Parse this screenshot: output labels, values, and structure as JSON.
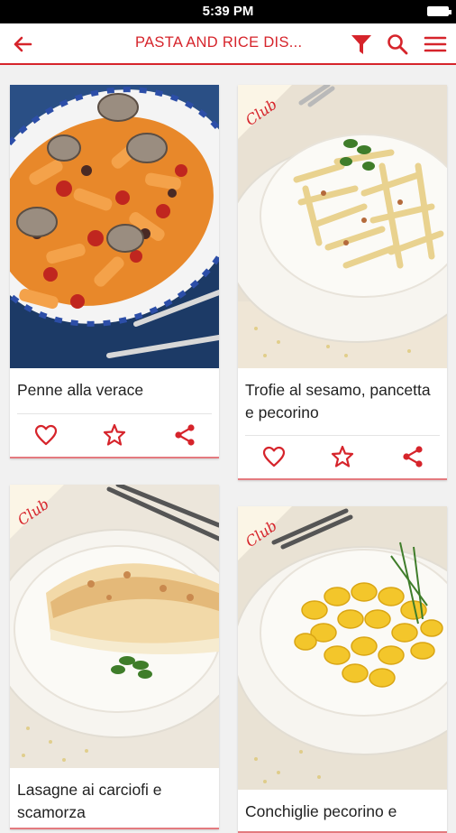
{
  "status_bar": {
    "time": "5:39 PM"
  },
  "app_bar": {
    "title": "PASTA AND RICE DIS..."
  },
  "colors": {
    "brand": "#d6242b",
    "background": "#f1f1f1"
  },
  "icons": {
    "back": "arrow-left-icon",
    "filter": "funnel-icon",
    "search": "search-icon",
    "menu": "hamburger-menu-icon",
    "like": "heart-outline-icon",
    "favorite": "star-outline-icon",
    "share": "share-icon"
  },
  "recipes": [
    {
      "name": "Penne alla verace",
      "club_badge": false,
      "badge_text": ""
    },
    {
      "name": "Trofie al sesamo, pancetta e pecorino",
      "club_badge": true,
      "badge_text": "Club"
    },
    {
      "name": "Lasagne ai carciofi e scamorza",
      "club_badge": true,
      "badge_text": "Club"
    },
    {
      "name": "Conchiglie pecorino e",
      "club_badge": true,
      "badge_text": "Club"
    }
  ]
}
